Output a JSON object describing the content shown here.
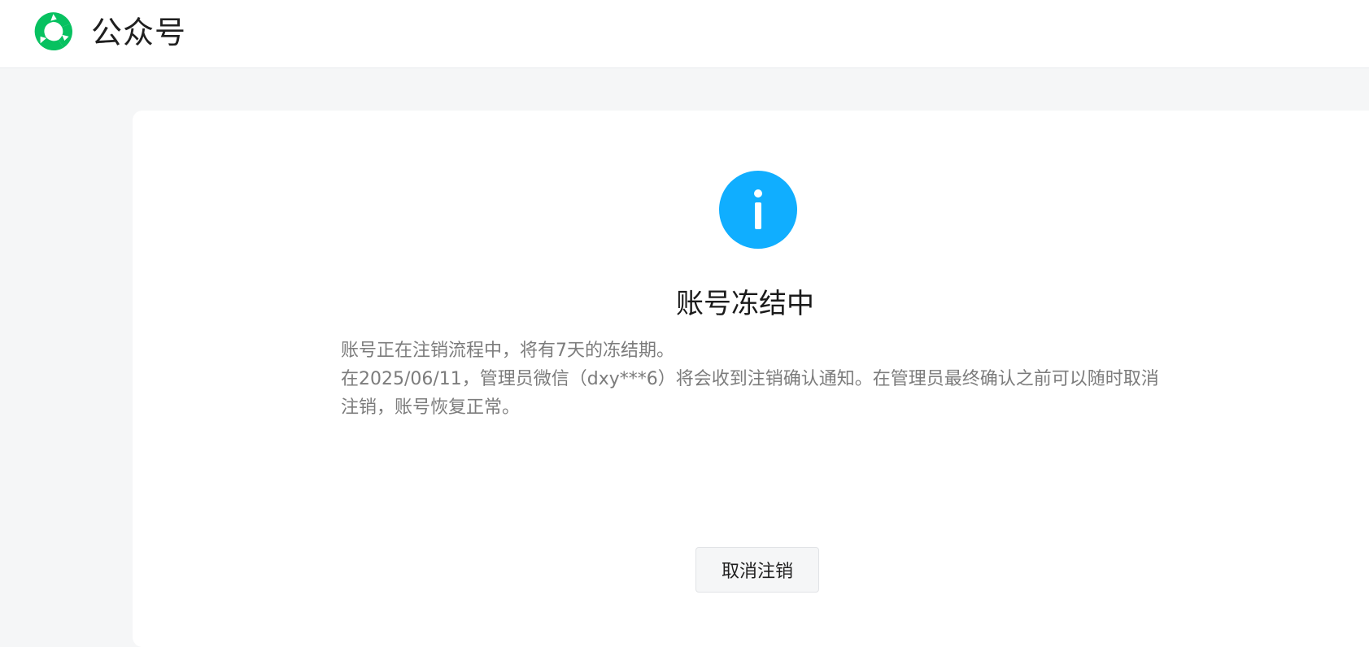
{
  "header": {
    "brand": "公众号",
    "logo_icon": "wechat-official-account-logo-icon",
    "brand_color": "#07c160"
  },
  "notice": {
    "icon": "info-icon",
    "icon_color": "#10aeff",
    "title": "账号冻结中",
    "line1": "账号正在注销流程中，将有7天的冻结期。",
    "line2": "在2025/06/11，管理员微信（dxy***6）将会收到注销确认通知。在管理员最终确认之前可以随时取消注销，账号恢复正常。"
  },
  "actions": {
    "cancel_label": "取消注销"
  }
}
